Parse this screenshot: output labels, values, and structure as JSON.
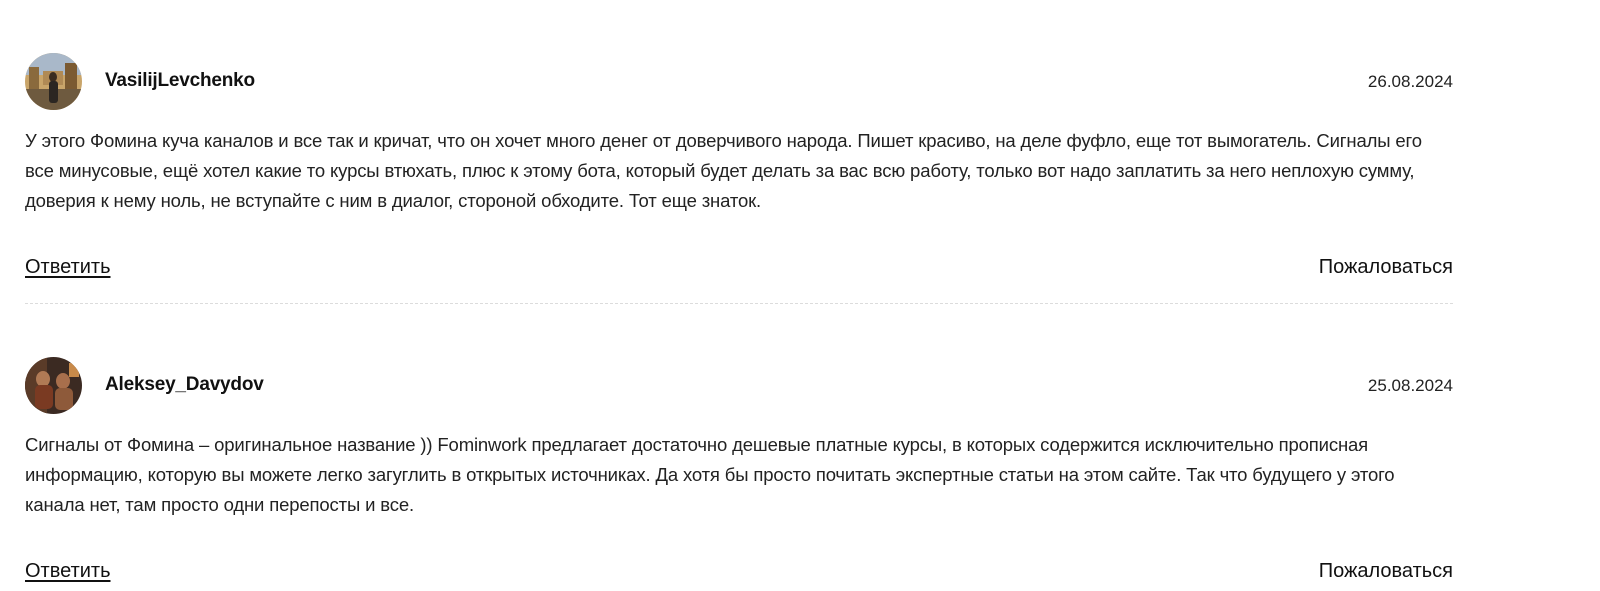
{
  "comments": [
    {
      "author": "VasilijLevchenko",
      "date": "26.08.2024",
      "text": "У этого Фомина куча каналов и все так и кричат, что он хочет много денег от доверчивого народа. Пишет красиво, на деле фуфло, еще тот вымогатель. Сигналы его все минусовые, ещё хотел какие то курсы втюхать, плюс к этому бота, который будет делать за вас всю работу, только вот надо заплатить за него неплохую сумму, доверия к нему ноль, не вступайте с ним в диалог, стороной обходите. Тот еще знаток.",
      "reply_label": "Ответить",
      "report_label": "Пожаловаться"
    },
    {
      "author": "Aleksey_Davydov",
      "date": "25.08.2024",
      "text": "Сигналы от Фомина – оригинальное название )) Fominwork предлагает достаточно дешевые платные курсы, в которых содержится исключительно прописная информацию, которую вы можете легко загуглить в открытых источниках. Да хотя бы просто почитать экспертные статьи на этом сайте. Так что будущего у этого канала нет, там просто одни перепосты и все.",
      "reply_label": "Ответить",
      "report_label": "Пожаловаться"
    }
  ]
}
